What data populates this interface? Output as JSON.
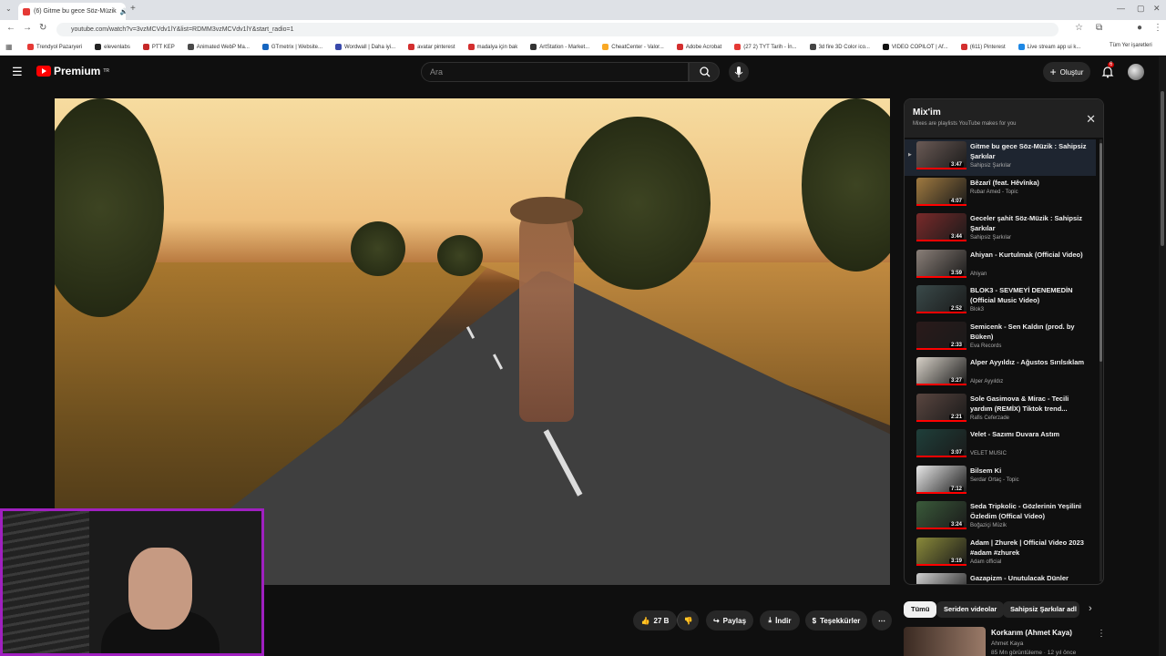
{
  "browser": {
    "tab_title": "(6) Gitme bu gece Söz-Müzik",
    "url": "youtube.com/watch?v=3vzMCVdv1lY&list=RDMM3vzMCVdv1lY&start_radio=1",
    "bookmarks": [
      "Trendyol Pazaryeri",
      "elevenlabs",
      "PTT KEP",
      "Animated WebP Ma...",
      "GTmetrix | Website...",
      "Wordwall | Daha iyi...",
      "avatar pinterest",
      "madalya için bak",
      "ArtStation - Market...",
      "CheatCenter - Valor...",
      "Adobe Acrobat",
      "(27 2) TYT Tarih - İn...",
      "3d fire 3D Color ico...",
      "VIDEO COPILOT | Af...",
      "(611) Pinterest",
      "Live stream app ui k..."
    ],
    "all_bookmarks": "Tüm Yer işaretleri"
  },
  "header": {
    "logo": "Premium",
    "logo_sup": "TR",
    "search_placeholder": "Ara",
    "create_label": "Oluştur",
    "notif_count": "6"
  },
  "actions": {
    "likes": "27 B",
    "share": "Paylaş",
    "download": "İndir",
    "thanks": "Teşekkürler"
  },
  "panel": {
    "title": "Mix'im",
    "subtitle": "Mixes are playlists YouTube makes for you",
    "items": [
      {
        "title": "Gitme bu gece Söz-Müzik : Sahipsiz Şarkılar",
        "channel": "Sahipsiz Şarkılar",
        "duration": "3:47",
        "color": "#6a5a55"
      },
      {
        "title": "Bêzarî (feat. Hêvînka)",
        "channel": "Rubar Amed - Topic",
        "duration": "4:07",
        "color": "#a07a40"
      },
      {
        "title": "Geceler şahit Söz-Müzik : Sahipsiz Şarkılar",
        "channel": "Sahipsiz Şarkılar",
        "duration": "3:44",
        "color": "#7a2a2a"
      },
      {
        "title": "Ahiyan - Kurtulmak (Official Video)",
        "channel": "Ahiyan",
        "duration": "3:59",
        "color": "#8a7f78"
      },
      {
        "title": "BLOK3 - SEVMEYİ DENEMEDİN (Official Music Video)",
        "channel": "Blok3",
        "duration": "2:52",
        "color": "#3a4a4a"
      },
      {
        "title": "Semicenk - Sen Kaldın (prod. by Büken)",
        "channel": "Eva Records",
        "duration": "2:33",
        "color": "#2a1a1a"
      },
      {
        "title": "Alper Ayyıldız - Ağustos Sırılsıklam",
        "channel": "Alper Ayyıldız",
        "duration": "3:27",
        "color": "#d8d2c8"
      },
      {
        "title": "Sole Gasimova & Mirac - Tecili yardım (REMİX) Tiktok trend...",
        "channel": "Rafis Ceferzade",
        "duration": "2:21",
        "color": "#5a4640"
      },
      {
        "title": "Velet - Sazımı Duvara Astım",
        "channel": "VELET MUSIC",
        "duration": "3:07",
        "color": "#1f3f3a"
      },
      {
        "title": "Bilsem Ki",
        "channel": "Serdar Ortaç - Topic",
        "duration": "7:12",
        "color": "#e8e8e8"
      },
      {
        "title": "Seda Tripkolic - Gözlerinin Yeşilini Özledim (Offical Video)",
        "channel": "Boğaziçi Müzik",
        "duration": "3:24",
        "color": "#3a5a3a"
      },
      {
        "title": "Adam | Zhurek | Official Video 2023 #adam #zhurek",
        "channel": "Adam official",
        "duration": "3:19",
        "color": "#8a8a3a"
      },
      {
        "title": "Gazapizm - Unutulacak Dünler",
        "channel": "Gazapizm35",
        "duration": "",
        "color": "#d0d0d0"
      }
    ]
  },
  "chips": [
    "Tümü",
    "Seriden videolar",
    "Sahipsiz Şarkılar adl"
  ],
  "recommendation": {
    "title": "Korkarım (Ahmet Kaya)",
    "channel": "Ahmet Kaya",
    "meta": "85 Mn görüntüleme · 12 yıl önce"
  }
}
